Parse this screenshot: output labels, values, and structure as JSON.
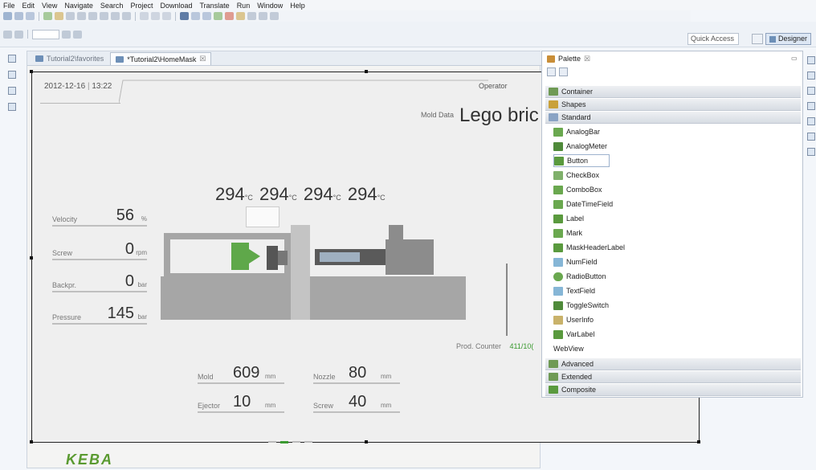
{
  "menu": [
    "File",
    "Edit",
    "View",
    "Navigate",
    "Search",
    "Project",
    "Download",
    "Translate",
    "Run",
    "Window",
    "Help"
  ],
  "toolbar": {
    "quick_access": "Quick Access",
    "perspective_label": "Designer"
  },
  "editor": {
    "tabs": [
      {
        "label": "Tutorial2\\favorites",
        "active": false
      },
      {
        "label": "*Tutorial2\\HomeMask",
        "active": true,
        "close": "☒"
      }
    ]
  },
  "mask": {
    "date": "2012-12-16",
    "time": "13:22",
    "operator": "Operator",
    "mold_data_label": "Mold Data",
    "mold_name": "Lego bric",
    "temps": [
      {
        "value": "294",
        "unit": "°C"
      },
      {
        "value": "294",
        "unit": "°C"
      },
      {
        "value": "294",
        "unit": "°C"
      },
      {
        "value": "294",
        "unit": "°C"
      }
    ],
    "metrics": [
      {
        "label": "Velocity",
        "value": "56",
        "unit": "%"
      },
      {
        "label": "Screw",
        "value": "0",
        "unit": "rpm"
      },
      {
        "label": "Backpr.",
        "value": "0",
        "unit": "bar"
      },
      {
        "label": "Pressure",
        "value": "145",
        "unit": "bar"
      }
    ],
    "bottom": [
      {
        "label": "Mold",
        "value": "609",
        "unit": "mm"
      },
      {
        "label": "Nozzle",
        "value": "80",
        "unit": "mm"
      },
      {
        "label": "Ejector",
        "value": "10",
        "unit": "mm"
      },
      {
        "label": "Screw",
        "value": "40",
        "unit": "mm"
      }
    ],
    "prod_counter_label": "Prod. Counter",
    "prod_counter_value": "411/10(",
    "logo": "KEBA"
  },
  "palette": {
    "title": "Palette",
    "close": "☒",
    "drawers_top": [
      "Container",
      "Shapes",
      "Standard"
    ],
    "standard_items": [
      "AnalogBar",
      "AnalogMeter",
      "Button",
      "CheckBox",
      "ComboBox",
      "DateTimeField",
      "Label",
      "Mark",
      "MaskHeaderLabel",
      "NumField",
      "RadioButton",
      "TextField",
      "ToggleSwitch",
      "UserInfo",
      "VarLabel",
      "WebView"
    ],
    "selected_item": "Button",
    "drawers_bottom": [
      "Advanced",
      "Extended",
      "Composite"
    ]
  },
  "colors": {
    "accent_green": "#3a9a30",
    "machine_gray": "#a6a6a6"
  }
}
